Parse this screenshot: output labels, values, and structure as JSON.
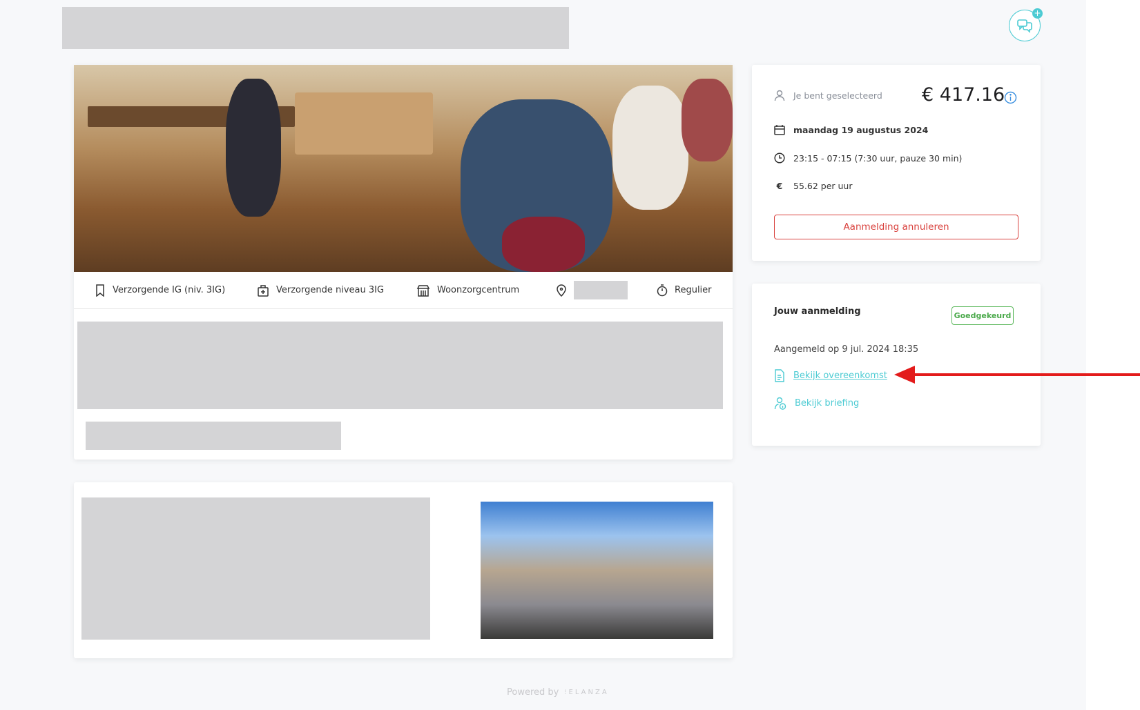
{
  "header": {
    "chat_icon": "chat-bubbles-icon",
    "chat_badge": "+"
  },
  "job": {
    "tags": [
      {
        "icon": "bookmark-icon",
        "label": "Verzorgende IG (niv. 3IG)"
      },
      {
        "icon": "medical-bag-icon",
        "label": "Verzorgende niveau 3IG"
      },
      {
        "icon": "store-icon",
        "label": "Woonzorgcentrum"
      },
      {
        "icon": "location-pin-icon",
        "label": ""
      },
      {
        "icon": "stopwatch-icon",
        "label": "Regulier"
      }
    ]
  },
  "summary": {
    "selected_label": "Je bent geselecteerd",
    "total": "€ 417.16",
    "date": "maandag 19 augustus 2024",
    "time": "23:15 - 07:15 (7:30 uur, pauze 30 min)",
    "euro_symbol": "€",
    "rate": "55.62 per uur",
    "cancel_label": "Aanmelding annuleren"
  },
  "registration": {
    "title": "Jouw aanmelding",
    "status": "Goedgekeurd",
    "registered_on": "Aangemeld op 9 jul. 2024 18:35",
    "agreement_link": "Bekijk overeenkomst",
    "briefing_link": "Bekijk briefing"
  },
  "footer": {
    "powered_by": "Powered by",
    "brand": "ELANZA"
  },
  "colors": {
    "accent": "#4ccbd3",
    "danger": "#d9413d",
    "success": "#5cb85c",
    "annotation": "#e31b1b"
  }
}
